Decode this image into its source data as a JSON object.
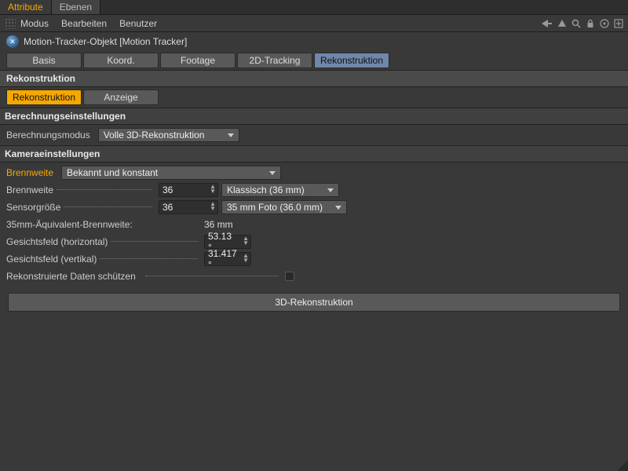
{
  "topTabs": {
    "active": "Attribute",
    "other": "Ebenen"
  },
  "menu": {
    "modus": "Modus",
    "bearbeiten": "Bearbeiten",
    "benutzer": "Benutzer"
  },
  "object": {
    "name": "Motion-Tracker-Objekt [Motion Tracker]"
  },
  "mainTabs": {
    "basis": "Basis",
    "koord": "Koord.",
    "footage": "Footage",
    "tracking2d": "2D-Tracking",
    "rekon": "Rekonstruktion"
  },
  "section": {
    "rekon": "Rekonstruktion"
  },
  "subTabs": {
    "rekon": "Rekonstruktion",
    "anzeige": "Anzeige"
  },
  "groups": {
    "berechnung": "Berechnungseinstellungen",
    "kamera": "Kameraeinstellungen"
  },
  "labels": {
    "berechnungsmodus": "Berechnungsmodus",
    "brennweite": "Brennweite",
    "sensorgroesse": "Sensorgröße",
    "eq35": "35mm-Äquivalent-Brennweite:",
    "fov_h": "Gesichtsfeld (horizontal)",
    "fov_v": "Gesichtsfeld (vertikal)",
    "protect": "Rekonstruierte Daten schützen"
  },
  "values": {
    "berechnungsmodus": "Volle 3D-Rekonstruktion",
    "brennweite_sel": "Bekannt und konstant",
    "brennweite_num": "36",
    "brennweite_preset": "Klassisch (36 mm)",
    "sensor_num": "36",
    "sensor_preset": "35 mm Foto (36.0 mm)",
    "eq35_val": "36 mm",
    "fov_h": "53.13 °",
    "fov_v": "31.417 °"
  },
  "button": {
    "run": "3D-Rekonstruktion"
  }
}
